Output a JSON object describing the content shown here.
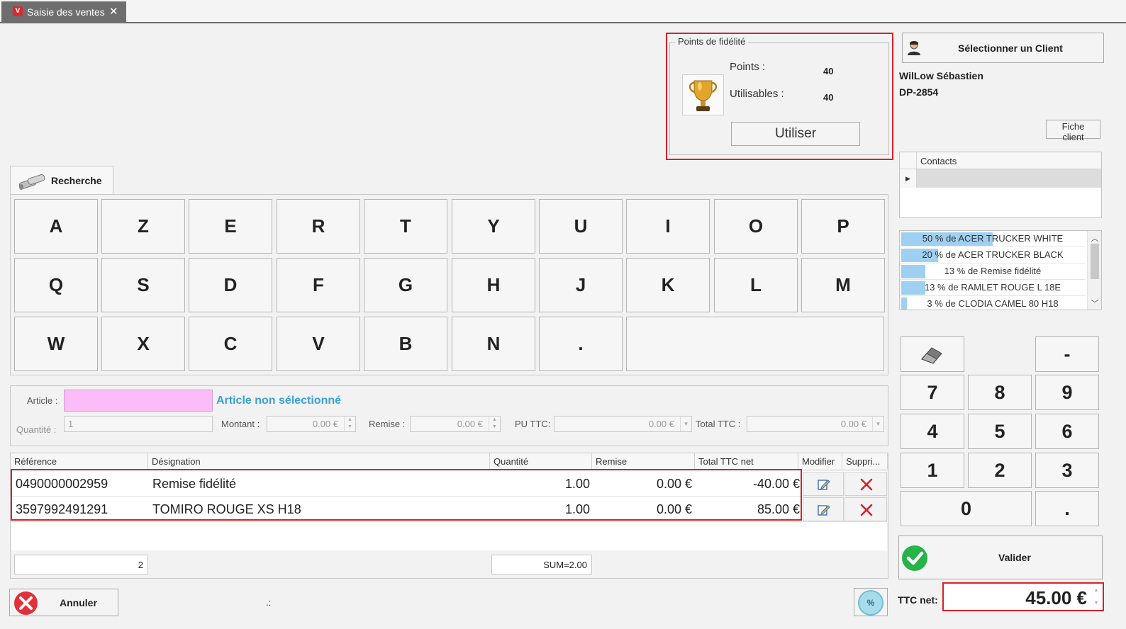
{
  "tab": {
    "title": "Saisie des ventes",
    "close": "✕",
    "icon": "V"
  },
  "loyalty": {
    "legend": "Points de fidélité",
    "points_label": "Points :",
    "points_value": "40",
    "usable_label": "Utilisables :",
    "usable_value": "40",
    "use_button": "Utiliser",
    "icon": "trophy-icon"
  },
  "client": {
    "select_button": "Sélectionner un Client",
    "name": "WilLow Sébastien",
    "code": "DP-2854",
    "card_button": "Fiche client",
    "contacts_header": "Contacts"
  },
  "promos": [
    {
      "text": "50 % de ACER TRUCKER WHITE",
      "level": 0.5
    },
    {
      "text": "20 % de ACER TRUCKER BLACK",
      "level": 0.2
    },
    {
      "text": "13 % de Remise fidélité",
      "level": 0.13
    },
    {
      "text": "13 % de RAMLET ROUGE L 18E",
      "level": 0.13
    },
    {
      "text": "3 % de CLODIA CAMEL 80 H18",
      "level": 0.03
    }
  ],
  "search": {
    "tab_label": "Recherche",
    "rows": [
      [
        "A",
        "Z",
        "E",
        "R",
        "T",
        "Y",
        "U",
        "I",
        "O",
        "P"
      ],
      [
        "Q",
        "S",
        "D",
        "F",
        "G",
        "H",
        "J",
        "K",
        "L",
        "M"
      ],
      [
        "W",
        "X",
        "C",
        "V",
        "B",
        "N",
        "."
      ]
    ]
  },
  "article": {
    "label": "Article :",
    "status": "Article non sélectionné",
    "quantity_label": "Quantité :",
    "quantity_value": "1",
    "amount_label": "Montant :",
    "amount_value": "0.00 €",
    "discount_label": "Remise :",
    "discount_value": "0.00 €",
    "unit_price_label": "PU TTC:",
    "unit_price_value": "0.00 €",
    "total_label": "Total TTC :",
    "total_value": "0.00 €"
  },
  "grid": {
    "headers": [
      "Référence",
      "Désignation",
      "Quantité",
      "Remise",
      "Total TTC net",
      "Modifier",
      "Suppri..."
    ],
    "rows": [
      {
        "ref": "0490000002959",
        "designation": "Remise fidélité",
        "qty": "1.00",
        "discount": "0.00 €",
        "total": "-40.00 €"
      },
      {
        "ref": "3597992491291",
        "designation": "TOMIRO ROUGE XS H18",
        "qty": "1.00",
        "discount": "0.00 €",
        "total": "85.00 €"
      }
    ],
    "count": "2",
    "sum": "SUM=2.00"
  },
  "numpad": {
    "keys": [
      "-",
      "7",
      "8",
      "9",
      "4",
      "5",
      "6",
      "1",
      "2",
      "3",
      "0",
      "."
    ],
    "validate": "Valider"
  },
  "footer": {
    "cancel": "Annuler",
    "status": ".:",
    "total_label": "TTC net:",
    "total_value": "45.00 €",
    "discount_icon": "%"
  },
  "colors": {
    "highlight": "#d9202a",
    "article_input": "#fcbcf8",
    "status_text": "#3aa0d9",
    "promo_bar": "#9fd0f2",
    "validate_green": "#27b24a",
    "cancel_red": "#e0323a"
  }
}
